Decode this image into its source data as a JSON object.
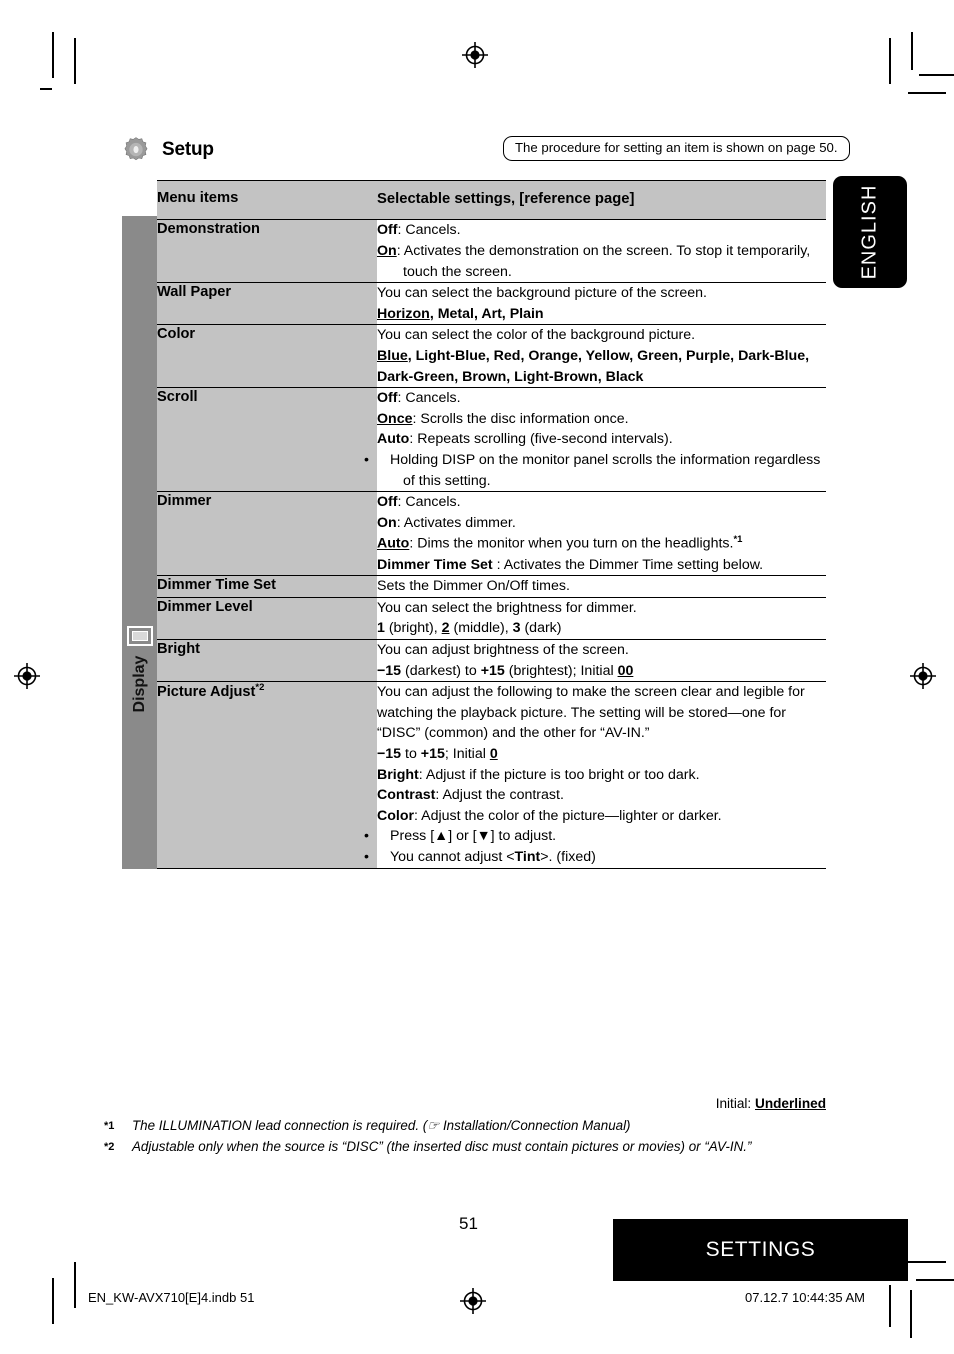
{
  "header": {
    "section_title": "Setup",
    "gear_icon": "gear-icon",
    "procedure_note": "The procedure for setting an item is shown on page 50.",
    "language_tab": "ENGLISH"
  },
  "category": {
    "label": "Display",
    "icon": "monitor-icon"
  },
  "table": {
    "columns": [
      "Menu items",
      "Selectable settings, [reference page]"
    ],
    "rows": [
      {
        "menu": "Demonstration",
        "lines": [
          {
            "bold": "Off",
            "rest": ": Cancels."
          },
          {
            "bold": "On",
            "underline": true,
            "rest": ": Activates the demonstration on the screen. To stop it temporarily,"
          },
          {
            "indent": "touch the screen."
          }
        ]
      },
      {
        "menu": "Wall Paper",
        "lines": [
          {
            "plain": "You can select the background picture of the screen."
          },
          {
            "allbold": "Horizon, Metal, Art, Plain",
            "ul_first": "Horizon"
          }
        ]
      },
      {
        "menu": "Color",
        "lines": [
          {
            "plain": "You can select the color of the background picture."
          },
          {
            "allbold": "Blue, Light-Blue, Red, Orange, Yellow, Green, Purple, Dark-Blue,",
            "ul_first": "Blue"
          },
          {
            "allbold": "Dark-Green, Brown, Light-Brown, Black"
          }
        ]
      },
      {
        "menu": "Scroll",
        "lines": [
          {
            "bold": "Off",
            "rest": ": Cancels."
          },
          {
            "bold": "Once",
            "underline": true,
            "rest": ": Scrolls the disc information once."
          },
          {
            "bold": "Auto",
            "rest": ": Repeats scrolling (five-second intervals)."
          },
          {
            "bullet": "Holding DISP on the monitor panel scrolls the information regardless"
          },
          {
            "indent": "of this setting."
          }
        ]
      },
      {
        "menu": "Dimmer",
        "lines": [
          {
            "bold": "Off",
            "rest": ": Cancels."
          },
          {
            "bold": "On",
            "rest": ": Activates dimmer."
          },
          {
            "bold": "Auto",
            "underline": true,
            "rest": ": Dims the monitor when you turn on the headlights.",
            "sup": "*1"
          },
          {
            "bold": "Dimmer Time Set",
            "rest": " : Activates the Dimmer Time setting below."
          }
        ]
      },
      {
        "menu": "Dimmer Time Set",
        "lines": [
          {
            "plain": "Sets the Dimmer On/Off times."
          }
        ]
      },
      {
        "menu": "Dimmer Level",
        "lines": [
          {
            "plain": "You can select the brightness for dimmer."
          },
          {
            "mixed": "1 (bright), 2 (middle), 3 (dark)"
          }
        ]
      },
      {
        "menu": "Bright",
        "lines": [
          {
            "plain": "You can adjust brightness of the screen."
          },
          {
            "mixed2": "−15 (darkest) to +15 (brightest); Initial 00"
          }
        ]
      },
      {
        "menu": "Picture Adjust",
        "menu_sup": "*2",
        "lines": [
          {
            "plain": "You can adjust the following to make the screen clear and legible for"
          },
          {
            "plain": "watching the playback picture. The setting will be stored—one for"
          },
          {
            "plain": "“DISC” (common) and the other for “AV-IN.”"
          },
          {
            "mixed3": "−15 to +15; Initial 0"
          },
          {
            "bold": "Bright",
            "rest": ": Adjust if the picture is too bright or too dark."
          },
          {
            "bold": "Contrast",
            "rest": ": Adjust the contrast."
          },
          {
            "bold": "Color",
            "rest": ": Adjust the color of the picture—lighter or darker."
          },
          {
            "bullet": "Press [▲] or [▼] to adjust."
          },
          {
            "bullet_tint": "You cannot adjust <Tint>. (fixed)"
          }
        ]
      }
    ]
  },
  "notes": {
    "initial_label": "Initial: ",
    "initial_value": "Underlined",
    "footnote1_mark": "*1",
    "footnote1": "The ILLUMINATION lead connection is required. (☞ Installation/Connection Manual)",
    "footnote2_mark": "*2",
    "footnote2": "Adjustable only when the source is “DISC” (the inserted disc must contain pictures or movies) or “AV-IN.”"
  },
  "footer": {
    "page_number": "51",
    "band_label": "SETTINGS",
    "file_name": "EN_KW-AVX710[E]4.indb   51",
    "timestamp": "07.12.7   10:44:35 AM"
  },
  "colors": {
    "menu_cell_bg": "#c3c3c3",
    "category_bar_bg": "#8a8a8a",
    "band_bg": "#000000",
    "page_bg": "#ffffff"
  }
}
